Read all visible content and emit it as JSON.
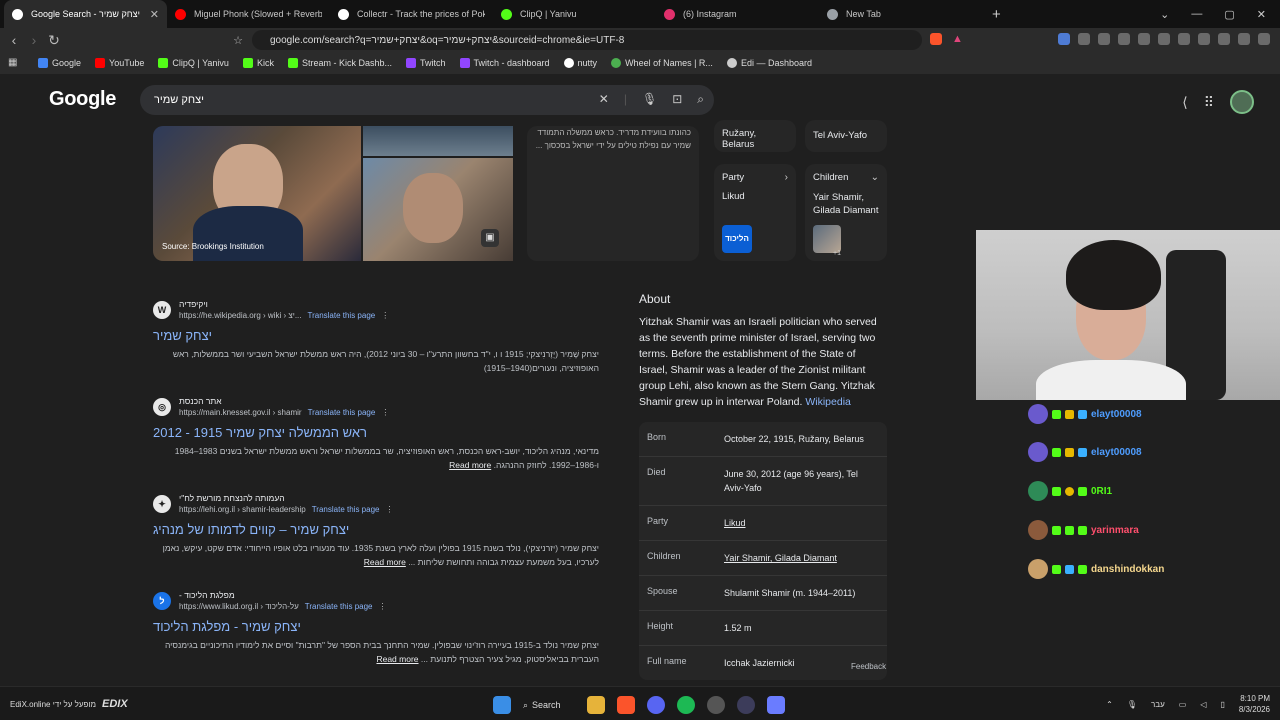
{
  "browser": {
    "tabs": [
      {
        "title": "Google Search - יצחק שמיר",
        "color": "#4285f4",
        "active": true
      },
      {
        "title": "Miguel Phonk (Slowed + Reverb)-Sin",
        "color": "#ff0000",
        "active": false
      },
      {
        "title": "Collectr - Track the prices of Pokemo",
        "color": "#ffffff",
        "active": false
      },
      {
        "title": "ClipQ | Yanivu",
        "color": "#53fc18",
        "active": false
      },
      {
        "title": "(6) Instagram",
        "color": "#e1306c",
        "active": false
      },
      {
        "title": "New Tab",
        "color": "#9aa0a6",
        "active": false
      }
    ],
    "close_glyph": "✕",
    "new_tab_glyph": "+",
    "url": "google.com/search?q=יצחק+שמיר&oq=יצחק+שמיר&sourceid=chrome&ie=UTF-8",
    "bookmarks": [
      {
        "label": "Google",
        "color": "#4285f4"
      },
      {
        "label": "YouTube",
        "color": "#ff0000"
      },
      {
        "label": "ClipQ | Yanivu",
        "color": "#53fc18"
      },
      {
        "label": "Kick",
        "color": "#53fc18"
      },
      {
        "label": "Stream - Kick Dashb...",
        "color": "#53fc18"
      },
      {
        "label": "Twitch",
        "color": "#9146ff"
      },
      {
        "label": "Twitch - dashboard",
        "color": "#9146ff"
      },
      {
        "label": "nutty",
        "color": "#ffffff"
      },
      {
        "label": "Wheel of Names | R...",
        "color": "#4caf50"
      },
      {
        "label": "Edi — Dashboard",
        "color": "#cccccc"
      }
    ]
  },
  "google": {
    "logo": "Google",
    "query": "יצחק שמיר"
  },
  "top_panel": {
    "image_source": "Source: Brookings Institution",
    "snippet": "כהונתו בוועידת מדריד. כראש ממשלה התמודד שמיר עם נפילת טילים על ידי ישראל בסכסוך ...",
    "place_top": "Ružany, Belarus",
    "place_right": "Tel Aviv-Yafo",
    "party_label": "Party",
    "party_value": "Likud",
    "party_logo": "הליכוד",
    "children_label": "Children",
    "children_value": "Yair Shamir, Gilada Diamant",
    "children_more": "+1"
  },
  "results": [
    {
      "site": "ויקיפדיה",
      "url": "https://he.wikipedia.org › wiki › יצ...",
      "fav": "W",
      "translate": "Translate this page",
      "title": "יצחק שמיר",
      "snippet": "יצחק שָׁמִיר (יֶזֶרנִיצקִי; 1915 ו ו, י\"ד בחשוון התרע\"ו – 30 ביוני 2012), היה ראש ממשלת ישראל השביעי ושר בממשלות, ראש האופוזיציה, ונעורים(1940–1915)",
      "read_more": ""
    },
    {
      "site": "אתר הכנסת",
      "url": "https://main.knesset.gov.il › shamir",
      "fav": "◎",
      "translate": "Translate this page",
      "title": "ראש הממשלה יצחק שמיר 1915 - 2012",
      "snippet": "מדינאי, מנהיג הליכוד, יושב-ראש הכנסת, ראש האופוזיציה, שר בממשלות ישראל וראש ממשלת ישראל בשנים 1983–1984 ו-1986–1992. לחוזק ההנהגה.",
      "read_more": "Read more"
    },
    {
      "site": "העמותה להנצחת מורשת לח\"י",
      "url": "https://lehi.org.il › shamir-leadership",
      "fav": "✦",
      "translate": "Translate this page",
      "title": "יצחק שמיר – קווים לדמותו של מנהיג",
      "snippet": "יצחק שמיר (יזרניצקי), נולד בשנת 1915 בפולין ועלה לארץ בשנת 1935. עוד מנעוריו בלט אופיו הייחודי: אדם שקט, עיקש, נאמן לערכיו, בעל משמעת עצמית גבוהה ותחושת שליחות ...",
      "read_more": "Read more"
    },
    {
      "site": "מפלגת הליכוד -",
      "url": "https://www.likud.org.il › על-הליכוד",
      "fav": "ל",
      "translate": "Translate this page",
      "title": "יצחק שמיר - מפלגת הליכוד",
      "snippet": "יצחק שמיר נולד ב-1915 בעיירה רוז'ינוי שבפולין. שמיר התחנך בבית הספר של \"תרבות\" וסיים את לימודיו התיכוניים בגימנסיה העברית בביאליסטוק, מגיל צעיר הצטרף לתנועת ...",
      "read_more": "Read more"
    }
  ],
  "about": {
    "heading": "About",
    "text": "Yitzhak Shamir was an Israeli politician who served as the seventh prime minister of Israel, serving two terms. Before the establishment of the State of Israel, Shamir was a leader of the Zionist militant group Lehi, also known as the Stern Gang. Yitzhak Shamir grew up in interwar Poland.",
    "wiki_link": "Wikipedia"
  },
  "facts": [
    {
      "key": "Born",
      "value": "October 22, 1915, Ružany, Belarus"
    },
    {
      "key": "Died",
      "value": "June 30, 2012 (age 96 years), Tel Aviv-Yafo"
    },
    {
      "key": "Party",
      "value": "Likud"
    },
    {
      "key": "Children",
      "value": "Yair Shamir, Gilada Diamant"
    },
    {
      "key": "Spouse",
      "value": "Shulamit Shamir (m. 1944–2011)"
    },
    {
      "key": "Height",
      "value": "1.52 m"
    },
    {
      "key": "Full name",
      "value": "Icchak Jaziernicki"
    }
  ],
  "feedback": "Feedback",
  "chat": [
    {
      "user": "elayt00008",
      "color": "#4e9dff"
    },
    {
      "user": "elayt00008",
      "color": "#4e9dff"
    },
    {
      "user": "0RI1",
      "color": "#53fc18"
    },
    {
      "user": "yarinmara",
      "color": "#ff4f6d"
    },
    {
      "user": "danshindokkan",
      "color": "#f5d78e"
    }
  ],
  "taskbar": {
    "brand_text": "EdiX.online מופעל על ידי",
    "brand_logo": "EDIX",
    "search_label": "Search",
    "lang": "עבר",
    "time": "8:10 PM",
    "date": "8/3/2026"
  }
}
